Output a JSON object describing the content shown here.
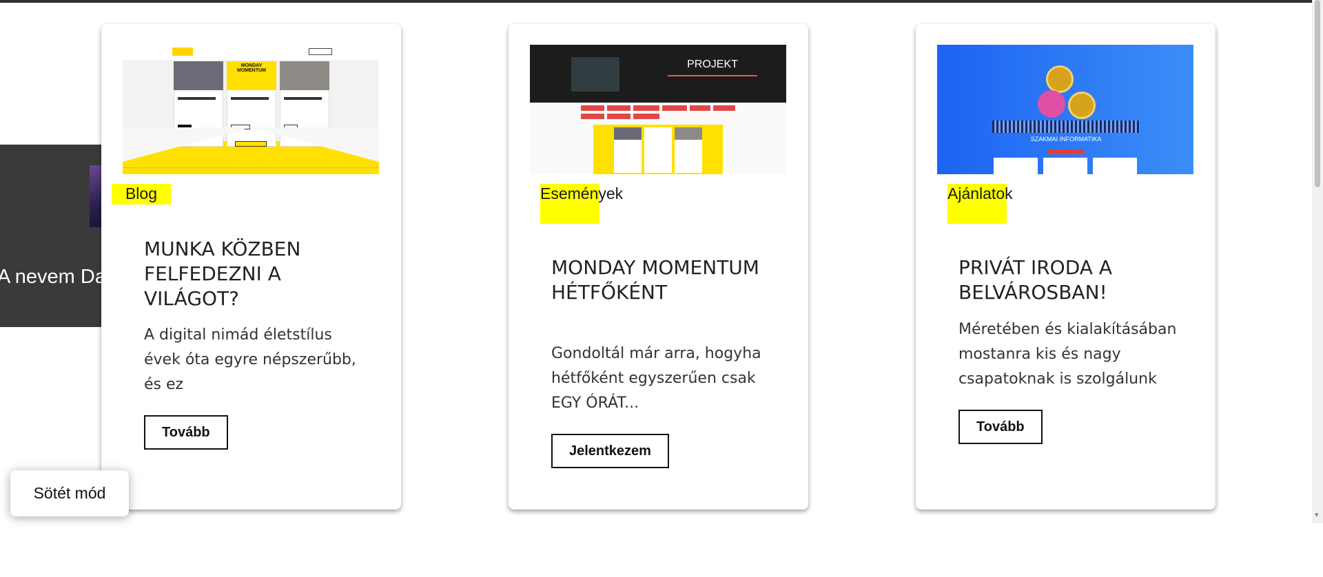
{
  "hero": {
    "text": "A nevem Da"
  },
  "cards": [
    {
      "category": "Blog",
      "title": "MUNKA KÖZBEN FELFEDEZNI A VILÁGOT?",
      "excerpt": "A digital nimád életstílus évek óta egyre népszerűbb, és ez",
      "button": "Tovább",
      "thumbnail_title": "MONDAY MOMENTUM"
    },
    {
      "category": "Események",
      "title": "MONDAY MOMENTUM HÉTFŐKÉNT",
      "excerpt": "Gondoltál már arra, hogyha hétfőként egyszerűen csak EGY ÓRÁT...",
      "button": "Jelentkezem",
      "thumbnail_title": "PROJEKT"
    },
    {
      "category": "Ajánlatok",
      "title": "PRIVÁT IRODA A BELVÁROSBAN!",
      "excerpt": "Méretében és kialakításában mostanra kis és nagy csapatoknak is szolgálunk",
      "button": "Tovább",
      "thumbnail_title": "SZAKMAI INFORMATIKA"
    }
  ],
  "dark_mode_toggle": "Sötét mód",
  "colors": {
    "tag_bg": "#ffff00",
    "topbar": "#2d3035",
    "hero_bg": "#3a3a3a"
  }
}
